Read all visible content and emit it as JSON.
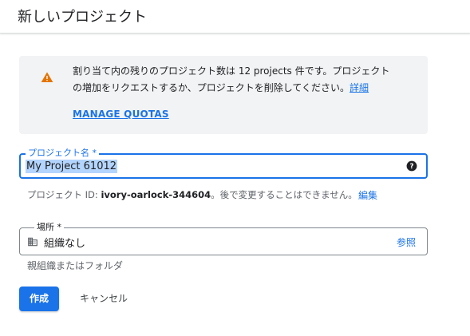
{
  "page": {
    "title": "新しいプロジェクト"
  },
  "notice": {
    "line1": "割り当て内の残りのプロジェクト数は 12 projects 件です。プロジェクト",
    "line2": "の増加をリクエストするか、プロジェクトを削除してください。",
    "details_link": "詳細",
    "manage_quotas": "MANAGE QUOTAS",
    "icon": "warning-icon",
    "icon_color": "#e37400"
  },
  "project_name": {
    "label": "プロジェクト名 *",
    "value": "My Project 61012",
    "help_icon": "help-icon"
  },
  "project_id": {
    "prefix": "プロジェクト ID: ",
    "id": "ivory-oarlock-344604",
    "suffix": "。後で変更することはできません。",
    "edit_link": "編集"
  },
  "location": {
    "label": "場所 *",
    "value": "組織なし",
    "browse": "参照",
    "icon": "organization-icon",
    "hint": "親組織またはフォルダ"
  },
  "actions": {
    "create": "作成",
    "cancel": "キャンセル"
  },
  "colors": {
    "accent": "#1a73e8",
    "notice_bg": "#f1f3f4",
    "selection": "#b3d4fc"
  }
}
